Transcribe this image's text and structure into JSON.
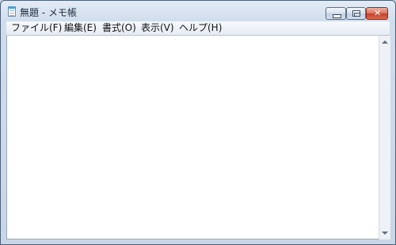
{
  "window": {
    "title": "無題 - メモ帳",
    "icon": "notepad-icon",
    "controls": {
      "minimize": "minimize-icon",
      "maximize": "maximize-icon",
      "close": "close-icon"
    },
    "colors": {
      "frame": "#c9d7e6",
      "close_button": "#c4412a",
      "edit_background": "#ffffff"
    }
  },
  "menu": {
    "file": "ファイル(F)",
    "edit": "編集(E)",
    "format": "書式(O)",
    "view": "表示(V)",
    "help": "ヘルプ(H)"
  },
  "editor": {
    "text": ""
  }
}
